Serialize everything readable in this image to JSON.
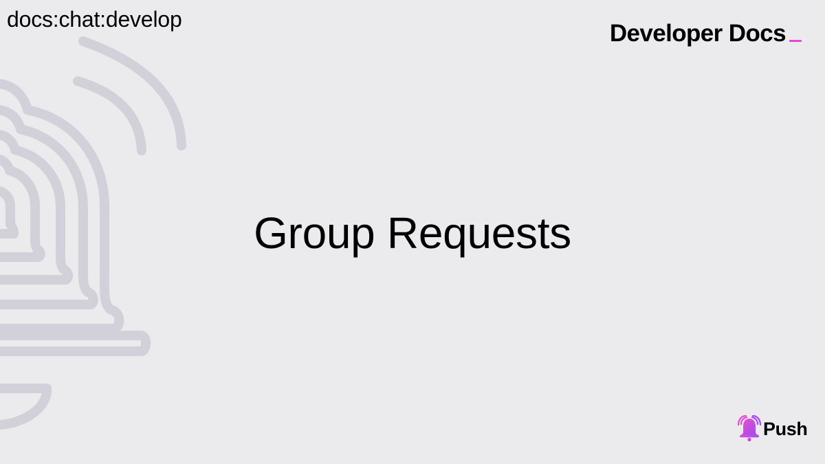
{
  "header": {
    "breadcrumb": "docs:chat:develop",
    "brand": "Developer Docs"
  },
  "main": {
    "title": "Group Requests"
  },
  "footer": {
    "logo_text": "Push"
  },
  "colors": {
    "background": "#ebebed",
    "decor_stroke": "#d2d1d9",
    "accent_pink": "#e24ad6",
    "accent_purple": "#a847f5"
  },
  "icons": {
    "background_art": "bell-with-signal-waves",
    "logo": "bell-icon"
  }
}
